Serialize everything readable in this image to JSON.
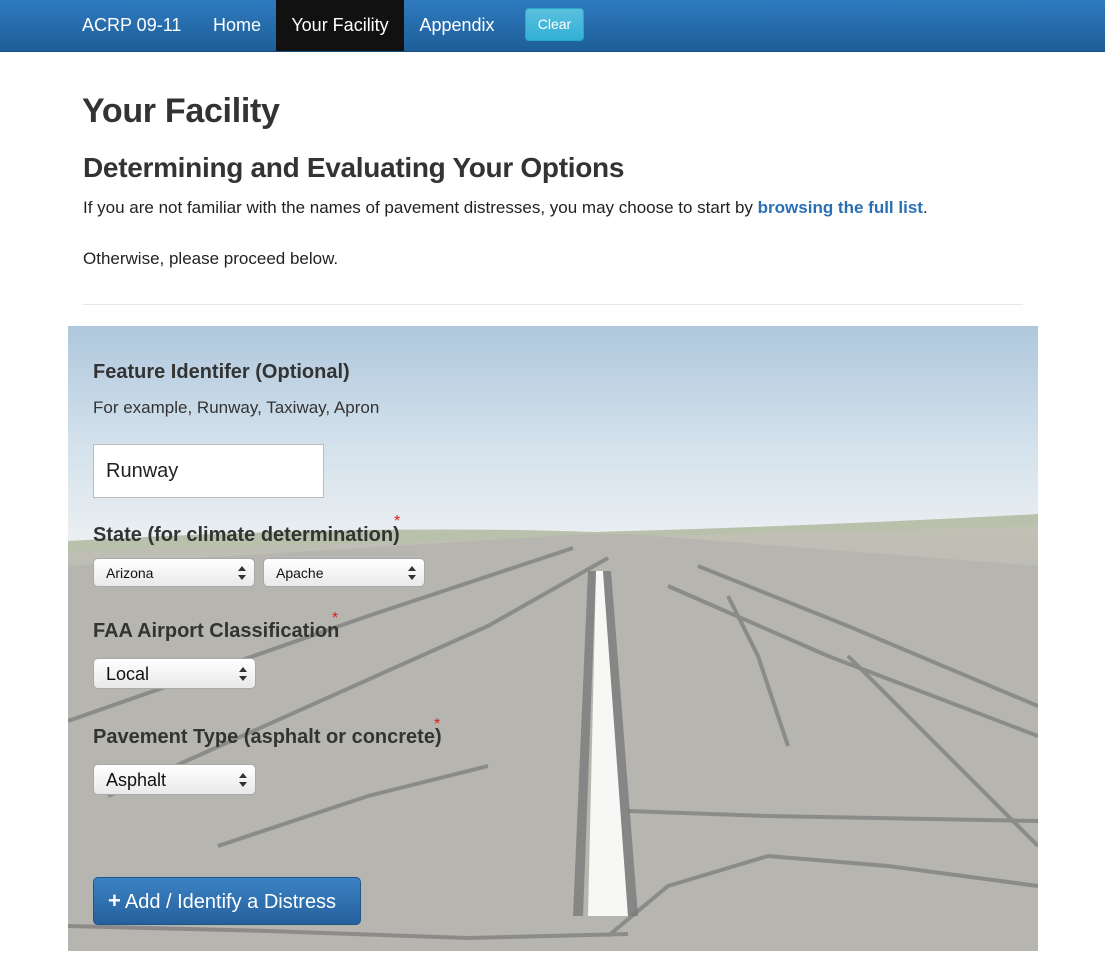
{
  "navbar": {
    "brand": "ACRP 09-11",
    "items": [
      {
        "label": "Home",
        "active": false
      },
      {
        "label": "Your Facility",
        "active": true
      },
      {
        "label": "Appendix",
        "active": false
      }
    ],
    "clear_label": "Clear",
    "colors": {
      "bar": "#2f7bbf",
      "active": "#111111",
      "clear": "#5bc0de"
    }
  },
  "page": {
    "title": "Your Facility",
    "subtitle": "Determining and Evaluating Your Options",
    "intro_text": "If you are not familiar with the names of pavement distresses, you may choose to start by ",
    "intro_link": "browsing the full list",
    "intro_end": ".",
    "proceed_text": "Otherwise, please proceed below."
  },
  "form": {
    "feature": {
      "label": "Feature Identifer (Optional)",
      "hint": "For example, Runway, Taxiway, Apron",
      "value": "Runway"
    },
    "state": {
      "label": "State (for climate determination)",
      "required_mark": "*",
      "state_value": "Arizona",
      "county_value": "Apache"
    },
    "classification": {
      "label": "FAA Airport Classification",
      "required_mark": "*",
      "value": "Local"
    },
    "pavement": {
      "label": "Pavement Type (asphalt or concrete)",
      "required_mark": "*",
      "value": "Asphalt"
    },
    "add_button": {
      "icon": "plus-icon",
      "label": "Add / Identify a Distress"
    }
  },
  "background": {
    "description_icon": "runway-scene-image"
  }
}
